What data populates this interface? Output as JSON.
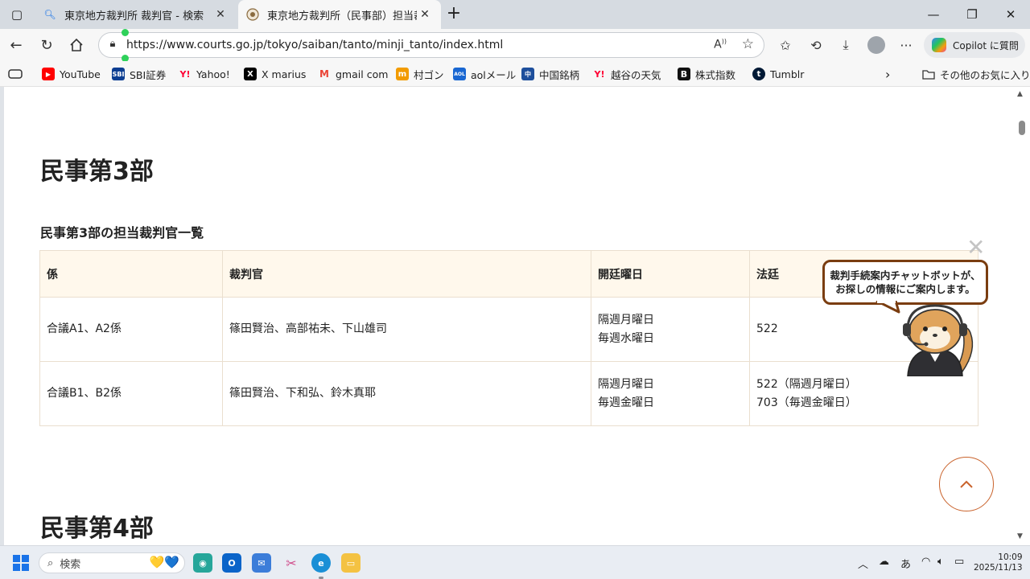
{
  "browser": {
    "tabs": [
      {
        "title": "東京地方裁判所 裁判官 - 検索",
        "favicon": "search-icon"
      },
      {
        "title": "東京地方裁判所（民事部）担当裁",
        "favicon": "court-seal-icon"
      }
    ],
    "url": "https://www.courts.go.jp/tokyo/saiban/tanto/minji_tanto/index.html",
    "copilot_label": "Copilot に質問",
    "bookmarks": [
      {
        "label": "YouTube",
        "icon": "youtube-icon",
        "color": "#ff0000"
      },
      {
        "label": "SBI証券",
        "icon": "sbi-icon",
        "color": "#0b3d91"
      },
      {
        "label": "Yahoo!",
        "icon": "yahoo-icon",
        "color": "#ff0033"
      },
      {
        "label": "X marius",
        "icon": "x-icon",
        "color": "#000000"
      },
      {
        "label": "gmail com",
        "icon": "gmail-icon",
        "color": "#ea4335"
      },
      {
        "label": "村ゴン",
        "icon": "mcdonalds-icon",
        "color": "#f29b00"
      },
      {
        "label": "aolメール",
        "icon": "aol-icon",
        "color": "#1967d2"
      },
      {
        "label": "中国銘柄",
        "icon": "chinese-stocks-icon",
        "color": "#1e4f9c"
      },
      {
        "label": "越谷の天気",
        "icon": "yahoo-weather-icon",
        "color": "#ff0033"
      },
      {
        "label": "株式指数",
        "icon": "b-icon",
        "color": "#111111"
      },
      {
        "label": "Tumblr",
        "icon": "tumblr-icon",
        "color": "#001935"
      }
    ],
    "other_favorites": "その他のお気に入り"
  },
  "page": {
    "section_title": "民事第3部",
    "table_caption": "民事第3部の担当裁判官一覧",
    "table": {
      "headers": [
        "係",
        "裁判官",
        "開廷曜日",
        "法廷"
      ],
      "rows": [
        {
          "kakari": "合議A1、A2係",
          "judges": "篠田賢治、高部祐未、下山雄司",
          "days": [
            "隔週月曜日",
            "毎週水曜日"
          ],
          "room": [
            "522"
          ]
        },
        {
          "kakari": "合議B1、B2係",
          "judges": "篠田賢治、下和弘、鈴木真耶",
          "days": [
            "隔週月曜日",
            "毎週金曜日"
          ],
          "room": [
            "522（隔週月曜日）",
            "703（毎週金曜日）"
          ]
        }
      ]
    },
    "next_section_title": "民事第4部",
    "chatbot": {
      "line1": "裁判手続案内チャットボットが、",
      "line2": "お探しの情報にご案内します。"
    }
  },
  "taskbar": {
    "search_placeholder": "検索",
    "ime": "あ",
    "time": "10:09",
    "date": "2025/11/13"
  },
  "colors": {
    "accent": "#c9622b",
    "table_header_bg": "#fff8ec",
    "bubble_border": "#7a3d10"
  }
}
